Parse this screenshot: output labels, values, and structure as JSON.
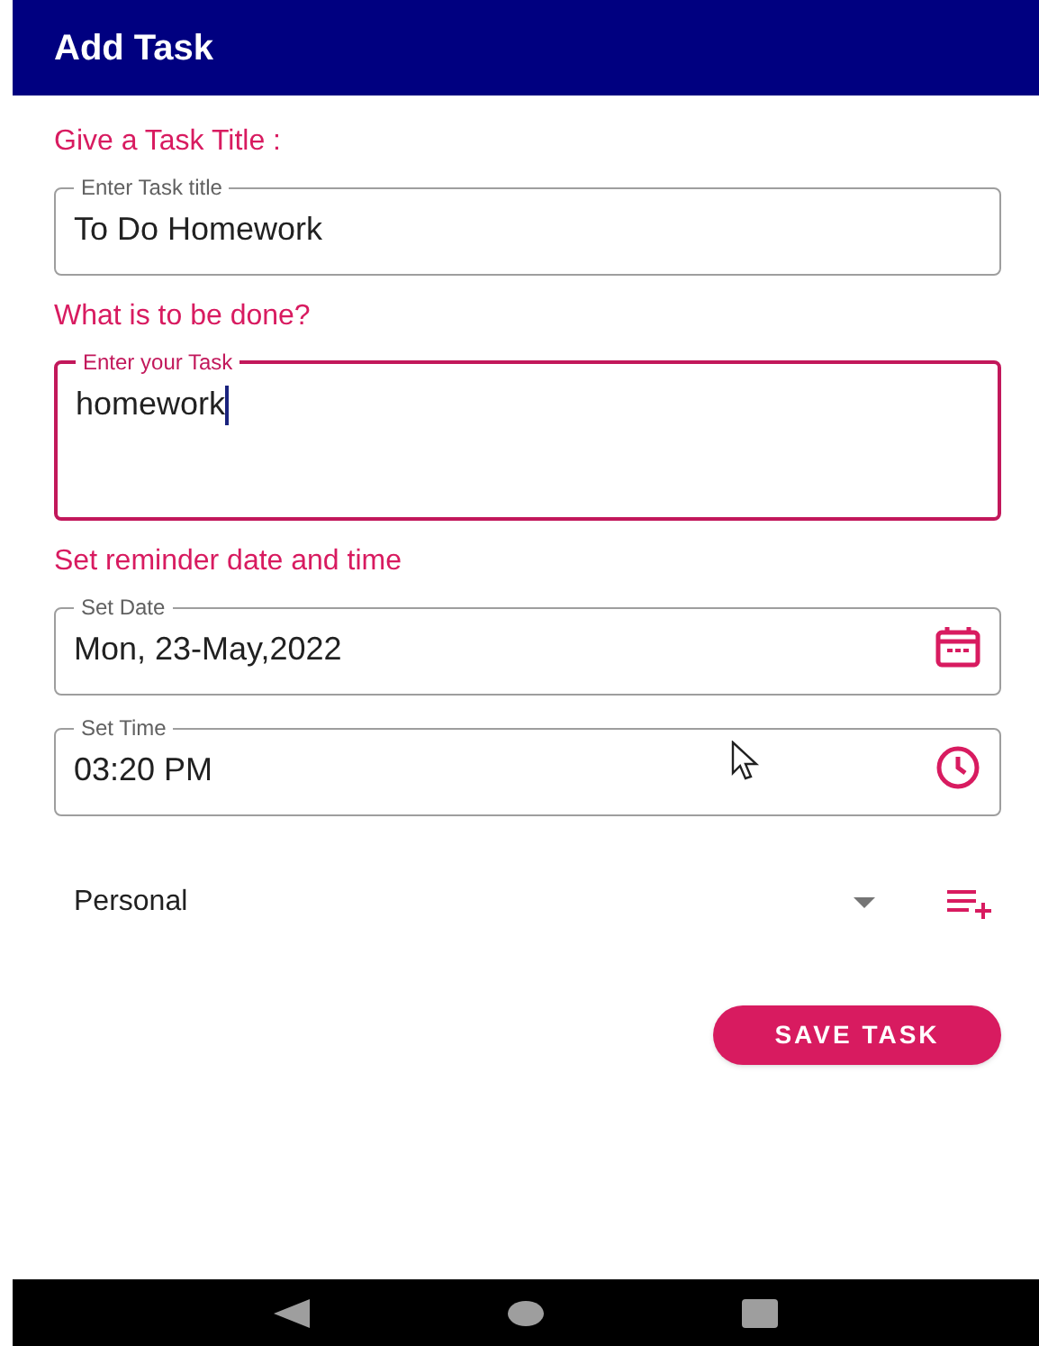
{
  "app_bar": {
    "title": "Add Task"
  },
  "sections": [
    {
      "heading": "Give a Task Title :",
      "fields": [
        {
          "kind": "text",
          "label": "Enter Task title",
          "value": "To Do Homework",
          "focused": false
        }
      ]
    },
    {
      "heading": "What is to be done?",
      "fields": [
        {
          "kind": "multiline",
          "label": "Enter your Task",
          "value": "homework",
          "focused": true
        }
      ]
    },
    {
      "heading": "Set reminder date and time",
      "fields": [
        {
          "kind": "date",
          "label": "Set Date",
          "value": "Mon, 23-May,2022",
          "focused": false
        },
        {
          "kind": "time",
          "label": "Set Time",
          "value": "03:20 PM",
          "focused": false
        }
      ]
    }
  ],
  "category": {
    "value": "Personal"
  },
  "save_button": {
    "label": "SAVE TASK"
  }
}
